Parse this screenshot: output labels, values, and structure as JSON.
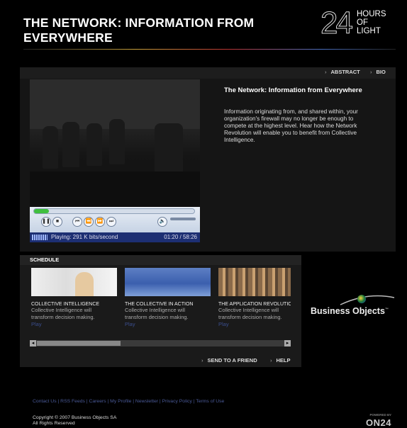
{
  "header": {
    "title": "THE NETWORK: INFORMATION FROM EVERYWHERE",
    "logo_number": "24",
    "logo_lines": [
      "HOURS",
      "OF",
      "LIGHT"
    ]
  },
  "tabs": {
    "abstract": "ABSTRACT",
    "bio": "BIO"
  },
  "player": {
    "status": "Playing: 291 K bits/second",
    "time": "01:20 / 58:26",
    "progress": 0.023,
    "volume": 0.75
  },
  "description": {
    "title": "The Network: Information from Everywhere",
    "body": "Information originating from, and shared within, your organization's firewall may no longer be enough to compete at the highest level. Hear how the Network Revolution will enable you to benefit from Collective Intelligence."
  },
  "schedule": {
    "heading": "SCHEDULE",
    "items": [
      {
        "title": "COLLECTIVE INTELLIGENCE",
        "desc1": "Collective Intelligence will",
        "desc2": "transform decision making.",
        "action": "Play"
      },
      {
        "title": "THE COLLECTIVE IN ACTION",
        "desc1": "Collective Intelligence will",
        "desc2": "transform decision making.",
        "action": "Play"
      },
      {
        "title": "THE APPLICATION REVOLUTIO",
        "desc1": "Collective Intelligence will",
        "desc2": "transform decision making.",
        "action": "Play"
      }
    ]
  },
  "actions": {
    "send": "SEND TO A FRIEND",
    "help": "HELP"
  },
  "sponsor": {
    "name": "Business Objects",
    "tm": "™"
  },
  "footer": {
    "links": "Contact Us | RSS Feeds | Careers | My Profile | Newsletter | Privacy Policy | Terms of Use",
    "copyright_line1": "Copyright © 2007 Business Objects SA",
    "copyright_line2": "All Rights Reserved",
    "powered_by": "POWERED BY",
    "brand": "ON24"
  },
  "colors": {
    "background": "#000000",
    "panel": "#151515",
    "link": "#4a5a98",
    "status_bar": "#1d2f73"
  }
}
